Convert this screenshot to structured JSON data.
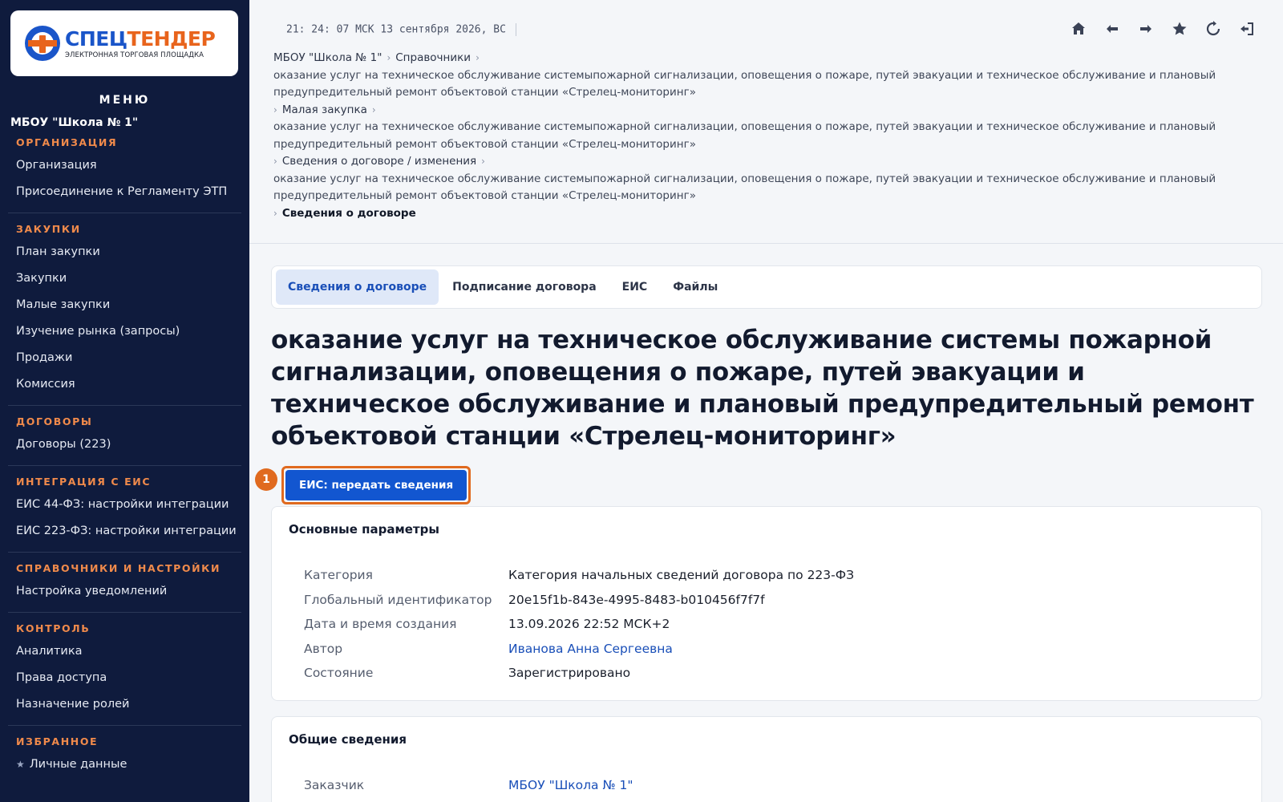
{
  "sidebar": {
    "logo": {
      "name_part1": "СПЕЦ",
      "name_part2": "ТЕНДЕР",
      "subtitle": "ЭЛЕКТРОННАЯ ТОРГОВАЯ ПЛОЩАДКА"
    },
    "menu_title": "МЕНЮ",
    "org_name": "МБОУ \"Школа № 1\"",
    "sections": [
      {
        "heading": "ОРГАНИЗАЦИЯ",
        "items": [
          "Организация",
          "Присоединение к Регламенту ЭТП"
        ]
      },
      {
        "heading": "ЗАКУПКИ",
        "items": [
          "План закупки",
          "Закупки",
          "Малые закупки",
          "Изучение рынка (запросы)",
          "Продажи",
          "Комиссия"
        ]
      },
      {
        "heading": "ДОГОВОРЫ",
        "items": [
          "Договоры (223)"
        ]
      },
      {
        "heading": "ИНТЕГРАЦИЯ С ЕИС",
        "items": [
          "ЕИС 44-ФЗ: настройки интеграции",
          "ЕИС 223-ФЗ: настройки интеграции"
        ]
      },
      {
        "heading": "СПРАВОЧНИКИ И НАСТРОЙКИ",
        "items": [
          "Настройка уведомлений"
        ]
      },
      {
        "heading": "КОНТРОЛЬ",
        "items": [
          "Аналитика",
          "Права доступа",
          "Назначение ролей"
        ]
      },
      {
        "heading": "ИЗБРАННОЕ",
        "items": [
          "Личные данные"
        ]
      }
    ]
  },
  "topbar": {
    "clock": "21: 24: 07 МСК  13 сентября 2026, ВС",
    "icons": [
      "home-icon",
      "back-arrow-icon",
      "forward-arrow-icon",
      "star-icon",
      "refresh-icon",
      "logout-icon"
    ]
  },
  "breadcrumbs": {
    "c1": "МБОУ \"Школа № 1\"",
    "c2": "Справочники",
    "long1": "оказание услуг на техническое обслуживание системыпожарной сигнализации, оповещения о пожаре, путей эвакуации и техническое обслуживание и плановый предупредительный ремонт объектовой станции «Стрелец-мониторинг»",
    "c3": "Малая закупка",
    "long2": "оказание услуг на техническое обслуживание системыпожарной сигнализации, оповещения о пожаре, путей эвакуации и техническое обслуживание и плановый предупредительный ремонт объектовой станции «Стрелец-мониторинг»",
    "c4": "Сведения о договоре / изменения",
    "long3": "оказание услуг на техническое обслуживание системыпожарной сигнализации, оповещения о пожаре, путей эвакуации и техническое обслуживание и плановый предупредительный ремонт объектовой станции «Стрелец-мониторинг»",
    "current": "Сведения о договоре"
  },
  "tabs": [
    "Сведения о договоре",
    "Подписание договора",
    "ЕИС",
    "Файлы"
  ],
  "page_title": "оказание услуг на техническое обслуживание системы пожарной сигнализации, оповещения о пожаре, путей эвакуации и техническое обслуживание и плановый предупредительный ремонт объектовой станции «Стрелец-мониторинг»",
  "action": {
    "step_number": "1",
    "eis_button": "ЕИС: передать сведения"
  },
  "main_params": {
    "title": "Основные параметры",
    "rows": [
      {
        "key": "Категория",
        "value": "Категория начальных сведений договора по 223-ФЗ"
      },
      {
        "key": "Глобальный идентификатор",
        "value": "20e15f1b-843e-4995-8483-b010456f7f7f"
      },
      {
        "key": "Дата и время создания",
        "value": "13.09.2026 22:52 МСК+2"
      },
      {
        "key": "Автор",
        "value": "Иванова Анна Сергеевна"
      },
      {
        "key": "Состояние",
        "value": "Зарегистрировано"
      }
    ]
  },
  "general_info": {
    "title": "Общие сведения",
    "rows": [
      {
        "key": "Заказчик",
        "value": "МБОУ \"Школа № 1\""
      }
    ]
  },
  "colors": {
    "sidebar_bg": "#0f1b3d",
    "accent_orange": "#e06a1f",
    "primary_blue": "#1256d0",
    "link_blue": "#1a4fb8"
  }
}
